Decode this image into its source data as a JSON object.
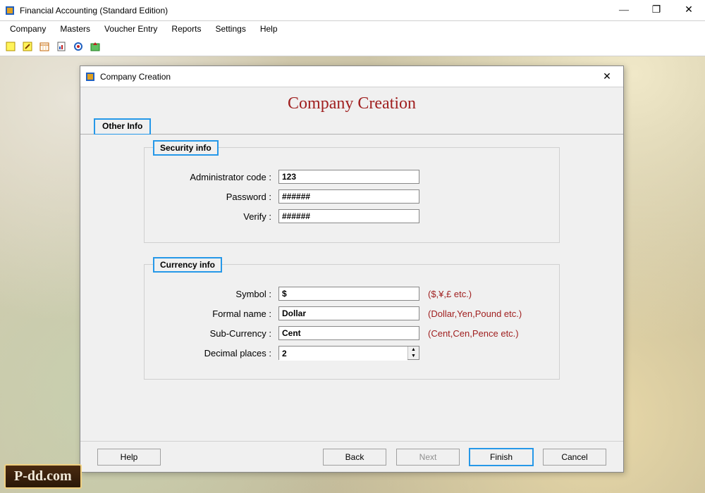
{
  "app": {
    "title": "Financial Accounting (Standard Edition)"
  },
  "menus": [
    "Company",
    "Masters",
    "Voucher Entry",
    "Reports",
    "Settings",
    "Help"
  ],
  "dialog": {
    "title": "Company Creation",
    "heading": "Company Creation",
    "tab": "Other Info",
    "security": {
      "legend": "Security info",
      "admin_label": "Administrator code :",
      "admin_value": "123",
      "password_label": "Password :",
      "password_value": "######",
      "verify_label": "Verify :",
      "verify_value": "######"
    },
    "currency": {
      "legend": "Currency info",
      "symbol_label": "Symbol :",
      "symbol_value": "$",
      "symbol_hint": "($,¥,£ etc.)",
      "formal_label": "Formal name :",
      "formal_value": "Dollar",
      "formal_hint": "(Dollar,Yen,Pound etc.)",
      "sub_label": "Sub-Currency :",
      "sub_value": "Cent",
      "sub_hint": "(Cent,Cen,Pence etc.)",
      "decimal_label": "Decimal places :",
      "decimal_value": "2"
    },
    "buttons": {
      "help": "Help",
      "back": "Back",
      "next": "Next",
      "finish": "Finish",
      "cancel": "Cancel"
    }
  },
  "watermark": "P-dd.com"
}
